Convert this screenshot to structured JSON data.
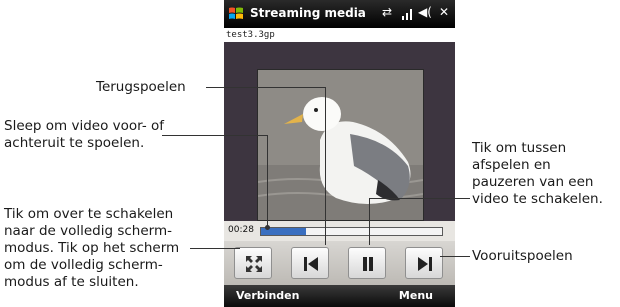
{
  "annotations": {
    "rewind": [
      "Terugspoelen"
    ],
    "seek": [
      "Sleep om video voor- of",
      "achteruit te spoelen."
    ],
    "fullscreen": [
      "Tik om over te schakelen",
      "naar de volledig scherm-",
      "modus. Tik op het scherm",
      "om de volledig scherm-",
      "modus af te sluiten."
    ],
    "playpause": [
      "Tik om tussen",
      "afspelen en",
      "pauzeren van een",
      "video te schakelen."
    ],
    "forward": [
      "Vooruitspoelen"
    ]
  },
  "phone": {
    "app_title": "Streaming media",
    "status_icons": [
      "connection-icon",
      "signal-icon",
      "volume-icon",
      "close-icon"
    ],
    "file_name": "test3.3gp",
    "time": "00:28",
    "progress": 0.25,
    "controls": [
      "fullscreen-icon",
      "rewind-icon",
      "pause-icon",
      "forward-icon"
    ],
    "softkey_left": "Verbinden",
    "softkey_right": "Menu"
  }
}
